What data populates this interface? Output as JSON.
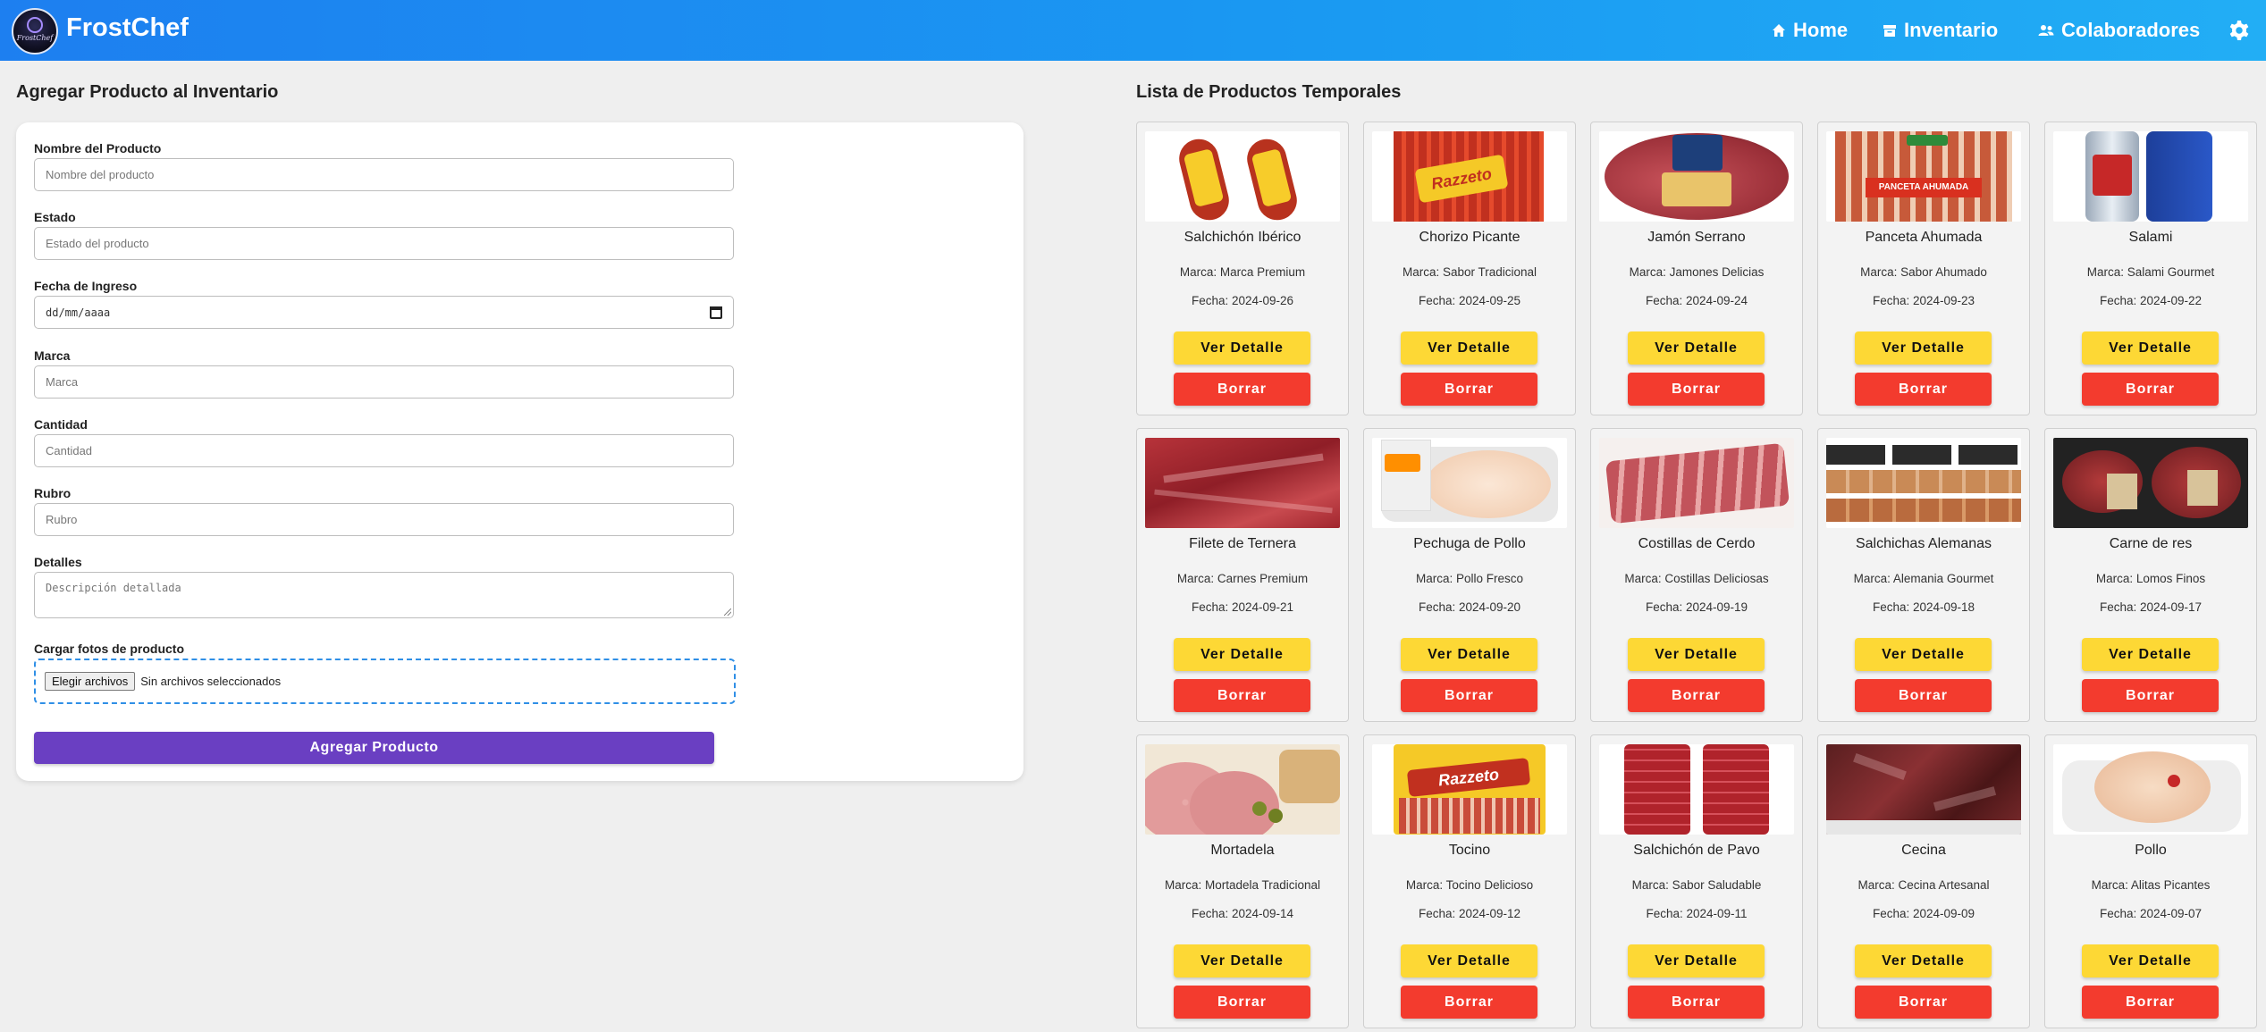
{
  "app": {
    "name": "FrostChef",
    "logo_text": "FrostChef"
  },
  "nav": {
    "home": "Home",
    "inventario": "Inventario",
    "colaboradores": "Colaboradores"
  },
  "form": {
    "title": "Agregar Producto al Inventario",
    "nombre_label": "Nombre del Producto",
    "nombre_placeholder": "Nombre del producto",
    "estado_label": "Estado",
    "estado_placeholder": "Estado del producto",
    "fecha_label": "Fecha de Ingreso",
    "fecha_placeholder": "dd/mm/aaaa",
    "marca_label": "Marca",
    "marca_placeholder": "Marca",
    "cantidad_label": "Cantidad",
    "cantidad_placeholder": "Cantidad",
    "rubro_label": "Rubro",
    "rubro_placeholder": "Rubro",
    "detalles_label": "Detalles",
    "detalles_placeholder": "Descripción detallada",
    "fotos_label": "Cargar fotos de producto",
    "file_button": "Elegir archivos",
    "file_status": "Sin archivos seleccionados",
    "submit": "Agregar Producto"
  },
  "list": {
    "title": "Lista de Productos Temporales",
    "detail_label": "Ver Detalle",
    "delete_label": "Borrar",
    "products": [
      {
        "name": "Salchichón Ibérico",
        "brand": "Marca: Marca Premium",
        "date": "Fecha: 2024-09-26",
        "image": "salchichon-ibérico-photo"
      },
      {
        "name": "Chorizo Picante",
        "brand": "Marca: Sabor Tradicional",
        "date": "Fecha: 2024-09-25",
        "image": "chorizo-picante-photo"
      },
      {
        "name": "Jamón Serrano",
        "brand": "Marca: Jamones Delicias",
        "date": "Fecha: 2024-09-24",
        "image": "jamón-serrano-photo"
      },
      {
        "name": "Panceta Ahumada",
        "brand": "Marca: Sabor Ahumado",
        "date": "Fecha: 2024-09-23",
        "image": "panceta-ahumada-photo"
      },
      {
        "name": "Salami",
        "brand": "Marca: Salami Gourmet",
        "date": "Fecha: 2024-09-22",
        "image": "salami-photo"
      },
      {
        "name": "Filete de Ternera",
        "brand": "Marca: Carnes Premium",
        "date": "Fecha: 2024-09-21",
        "image": "filete-de-ternera-photo"
      },
      {
        "name": "Pechuga de Pollo",
        "brand": "Marca: Pollo Fresco",
        "date": "Fecha: 2024-09-20",
        "image": "pechuga-de-pollo-photo"
      },
      {
        "name": "Costillas de Cerdo",
        "brand": "Marca: Costillas Deliciosas",
        "date": "Fecha: 2024-09-19",
        "image": "costillas-de-cerdo-photo"
      },
      {
        "name": "Salchichas Alemanas",
        "brand": "Marca: Alemania Gourmet",
        "date": "Fecha: 2024-09-18",
        "image": "salchichas-alemanas-photo"
      },
      {
        "name": "Carne de res",
        "brand": "Marca: Lomos Finos",
        "date": "Fecha: 2024-09-17",
        "image": "carne-de-res-photo"
      },
      {
        "name": "Mortadela",
        "brand": "Marca: Mortadela Tradicional",
        "date": "Fecha: 2024-09-14",
        "image": "mortadela-photo"
      },
      {
        "name": "Tocino",
        "brand": "Marca: Tocino Delicioso",
        "date": "Fecha: 2024-09-12",
        "image": "tocino-photo"
      },
      {
        "name": "Salchichón de Pavo",
        "brand": "Marca: Sabor Saludable",
        "date": "Fecha: 2024-09-11",
        "image": "salchichón-de-pavo-photo"
      },
      {
        "name": "Cecina",
        "brand": "Marca: Cecina Artesanal",
        "date": "Fecha: 2024-09-09",
        "image": "cecina-photo"
      },
      {
        "name": "Pollo",
        "brand": "Marca: Alitas Picantes",
        "date": "Fecha: 2024-09-07",
        "image": "pollo-photo"
      }
    ]
  },
  "icons": {
    "home": "home-icon",
    "inventario": "archive-icon",
    "colaboradores": "users-icon",
    "settings": "gear-icon",
    "calendar": "calendar-icon"
  },
  "colors": {
    "navbar": "#1d8ff0",
    "submit": "#6a3fc2",
    "detail": "#fdd835",
    "delete": "#f33b2e",
    "file_border": "#2f8fe6"
  }
}
